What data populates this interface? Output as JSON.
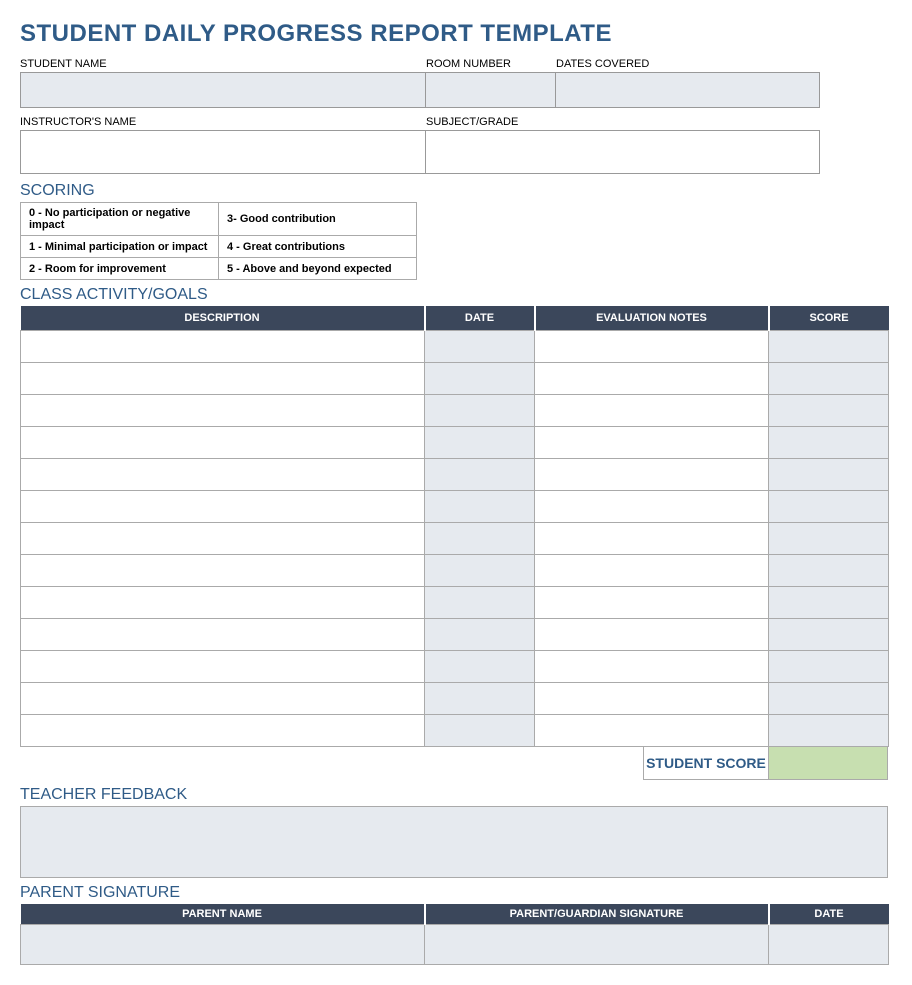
{
  "title": "STUDENT DAILY PROGRESS REPORT TEMPLATE",
  "fields": {
    "student_name_label": "STUDENT NAME",
    "room_number_label": "ROOM NUMBER",
    "dates_covered_label": "DATES COVERED",
    "instructor_name_label": "INSTRUCTOR'S NAME",
    "subject_grade_label": "SUBJECT/GRADE"
  },
  "scoring": {
    "heading": "SCORING",
    "rows": [
      {
        "left": "0 - No participation or negative impact",
        "right": "3- Good contribution"
      },
      {
        "left": "1 - Minimal participation or impact",
        "right": "4 - Great contributions"
      },
      {
        "left": "2 - Room for improvement",
        "right": "5 - Above and beyond expected"
      }
    ]
  },
  "activity": {
    "heading": "CLASS ACTIVITY/GOALS",
    "headers": {
      "description": "DESCRIPTION",
      "date": "DATE",
      "evaluation": "EVALUATION NOTES",
      "score": "SCORE"
    },
    "row_count": 13,
    "student_score_label": "STUDENT SCORE"
  },
  "feedback": {
    "heading": "TEACHER FEEDBACK"
  },
  "signature": {
    "heading": "PARENT SIGNATURE",
    "headers": {
      "name": "PARENT NAME",
      "sig": "PARENT/GUARDIAN SIGNATURE",
      "date": "DATE"
    }
  }
}
